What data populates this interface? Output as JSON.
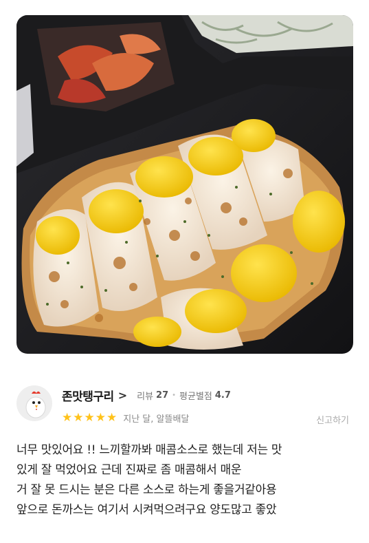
{
  "photo": {
    "alt_icon": "food-photo"
  },
  "reviewer": {
    "avatar_icon": "chicken-avatar-icon",
    "name": "존맛탱구리",
    "chevron": ">",
    "review_label": "리뷰",
    "review_count": "27",
    "avg_label": "평균별점",
    "avg_rating": "4.7",
    "star_count": 5,
    "date_text": "지난 달, 알뜰배달",
    "report_label": "신고하기"
  },
  "review": {
    "lines": [
      "너무 맛있어요 !! 느끼할까봐 매콤소스로 했는데 저는 맛",
      "있게 잘 먹었어요 근데 진짜로 좀 매콤해서 매운",
      "거 잘 못 드시는 분은 다른 소스로 하는게 좋을거같아용",
      "앞으로 돈까스는 여기서 시켜먹으려구요 양도많고 좋았"
    ]
  },
  "colors": {
    "star": "#ffc21a"
  }
}
